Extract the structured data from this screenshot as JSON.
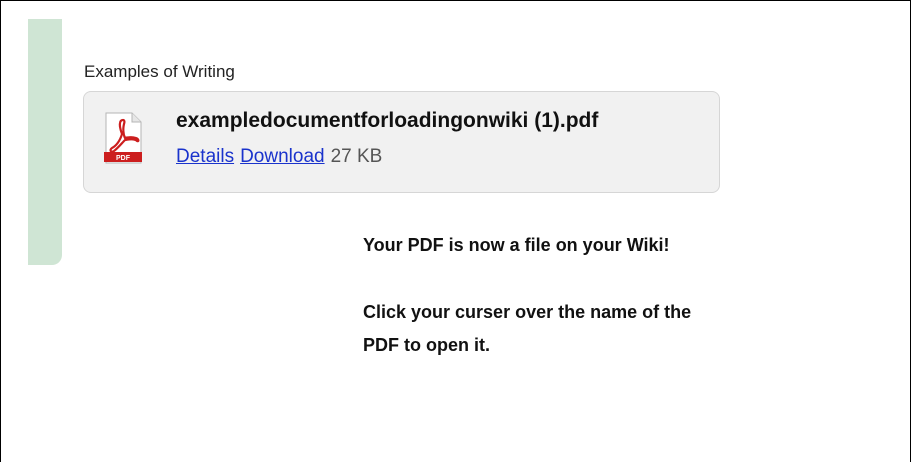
{
  "section": {
    "title": "Examples of Writing"
  },
  "file": {
    "name": "exampledocumentforloadingonwiki (1).pdf",
    "details_label": "Details",
    "download_label": "Download",
    "size": "27 KB",
    "icon": "pdf-file-icon",
    "icon_label": "PDF"
  },
  "notes": {
    "line1": "Your PDF is now a file on your Wiki!",
    "line2a": "Click your curser over the name of the",
    "line2b": "PDF to open it."
  },
  "colors": {
    "accent_bar": "#cfe5d4",
    "link": "#1a33cc",
    "card_bg": "#f1f1f1",
    "pdf_red": "#cc1e1e"
  }
}
